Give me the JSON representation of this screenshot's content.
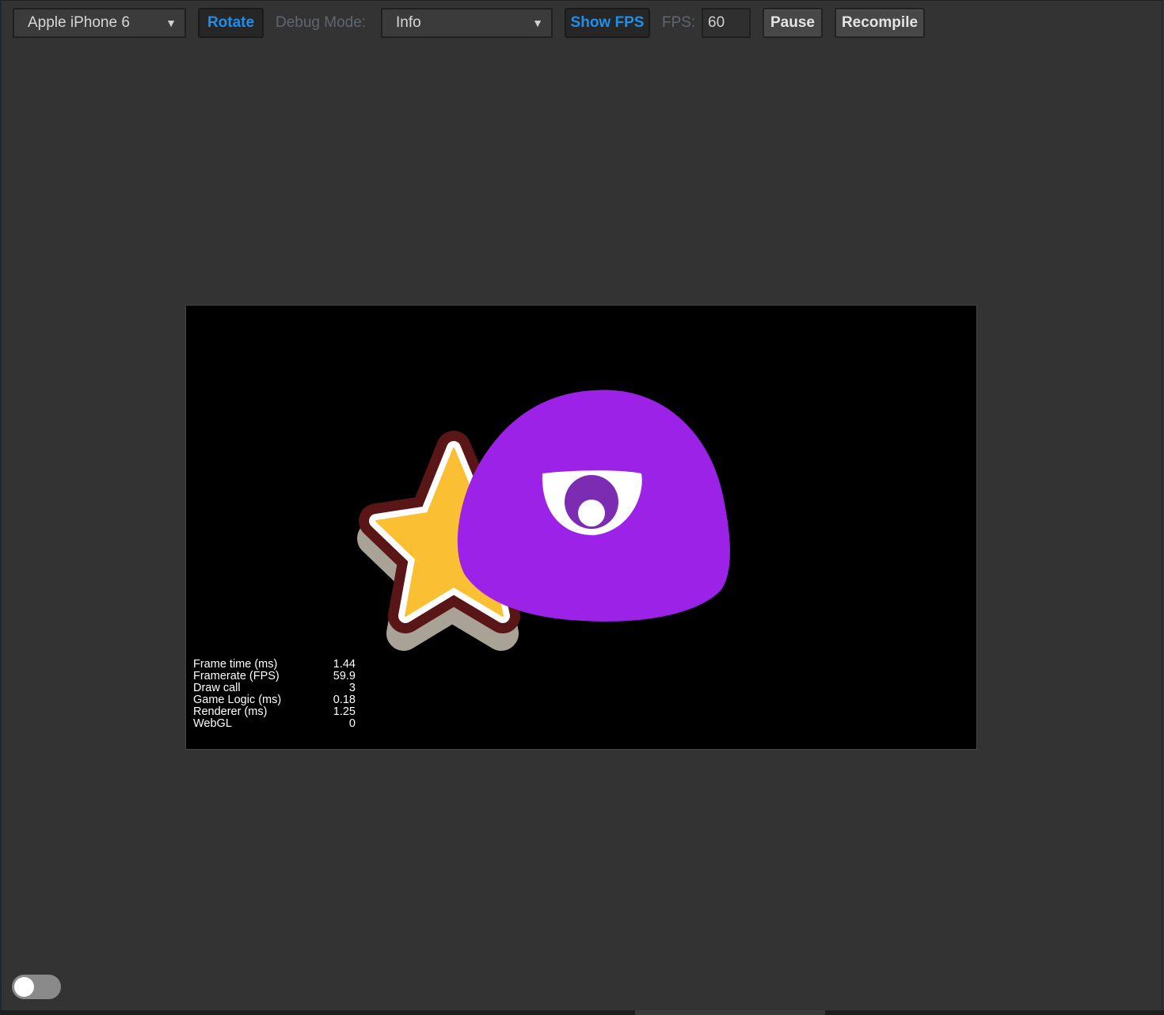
{
  "toolbar": {
    "device_select": {
      "value": "Apple iPhone 6"
    },
    "rotate_label": "Rotate",
    "debug_mode_label": "Debug Mode:",
    "debug_mode_select": {
      "value": "Info"
    },
    "show_fps_label": "Show FPS",
    "fps_label": "FPS:",
    "fps_value": "60",
    "pause_label": "Pause",
    "recompile_label": "Recompile"
  },
  "stats": [
    {
      "label": "Frame time (ms)",
      "value": "1.44"
    },
    {
      "label": "Framerate (FPS)",
      "value": "59.9"
    },
    {
      "label": "Draw call",
      "value": "3"
    },
    {
      "label": "Game Logic (ms)",
      "value": "0.18"
    },
    {
      "label": "Renderer (ms)",
      "value": "1.25"
    },
    {
      "label": "WebGL",
      "value": "0"
    }
  ],
  "colors": {
    "accent_active": "#1e8fea",
    "star_fill": "#fbbf33",
    "star_outline": "#5a1616",
    "blob": "#9b22e6"
  },
  "icons": {
    "dropdown": "caret-down-icon"
  },
  "toggle": {
    "on": false
  }
}
